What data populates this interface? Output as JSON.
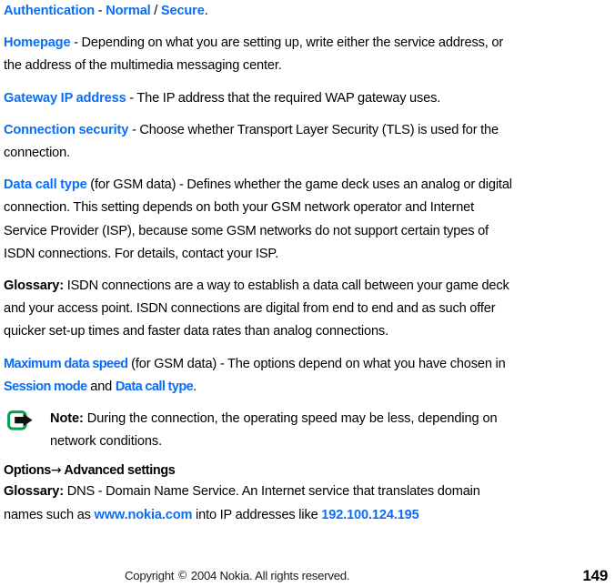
{
  "document": {
    "title": "Nokia N-Gage user guide page 149 - WAP / Access point settings",
    "accent_color": "#0a6ef5",
    "text_color": "#000000",
    "background_color": "#ffffff"
  },
  "body": {
    "authentication": {
      "term": "Authentication",
      "dash": " - ",
      "option_1": "Normal",
      "separator": " / ",
      "option_2": "Secure",
      "period": "."
    },
    "homepage": {
      "term": "Homepage",
      "text": " - Depending on what you are setting up, write either the service address, or the address of the multimedia messaging center."
    },
    "gateway": {
      "term": "Gateway IP address",
      "text": " - The IP address that the required WAP gateway uses."
    },
    "connection_security": {
      "term": "Connection security",
      "text": " - Choose whether Transport Layer Security (TLS) is used for the connection."
    },
    "data_call_type": {
      "term": "Data call type",
      "text": " (for GSM data) - Defines whether the game deck uses an analog or digital connection. This setting depends on both your GSM network operator and Internet Service Provider (ISP), because some GSM networks do not support certain types of ISDN connections. For details, contact your ISP."
    },
    "glossary_isdn": {
      "label": "Glossary:",
      "text": " ISDN connections are a way to establish a data call between your game deck and your access point. ISDN connections are digital from end to end and as such offer quicker set-up times and faster data rates than analog connections."
    },
    "maximum_data_speed": {
      "term": "Maximum data speed",
      "text_1": " (for GSM data) - The options depend on what you have chosen in ",
      "term_2": "Session mode",
      "text_2": " and ",
      "term_3": "Data call type",
      "text_3": "."
    },
    "note": {
      "icon": "nokia-note-arrow-icon",
      "label": "Note:",
      "text": "  During the connection, the operating speed may be less, depending on network conditions."
    },
    "options_heading": {
      "label_1": "Options",
      "arrow": "→",
      "label_2": " Advanced settings"
    },
    "glossary_dns": {
      "label": "Glossary:",
      "text_1": " DNS - Domain Name Service. An Internet service that translates domain names such as ",
      "link": "www.nokia.com",
      "text_2": " into IP addresses like ",
      "ip_address": "192.100.124.195"
    }
  },
  "footer": {
    "copyright_prefix": "Copyright ",
    "copyright_symbol": "©",
    "copyright_suffix": " 2004 Nokia. All rights reserved.",
    "page_number": "149"
  }
}
